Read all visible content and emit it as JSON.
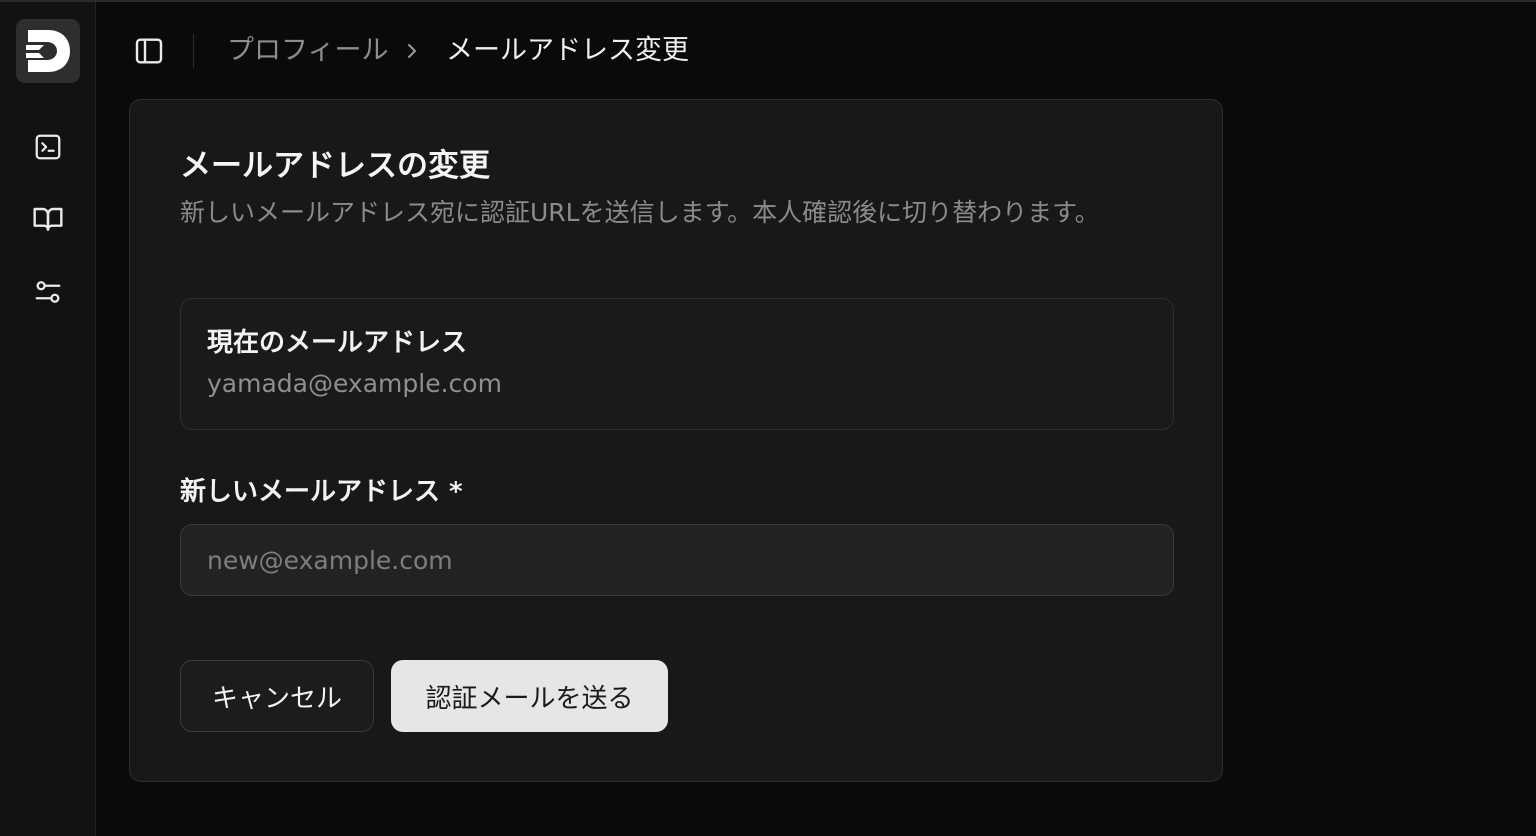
{
  "app": {
    "logo_icon": "d-logo-icon"
  },
  "sidebar": {
    "items": [
      {
        "icon": "terminal-icon"
      },
      {
        "icon": "book-open-icon"
      },
      {
        "icon": "settings-sliders-icon"
      }
    ]
  },
  "header": {
    "toggle_icon": "sidebar-toggle-icon",
    "breadcrumb": [
      "プロフィール",
      "メールアドレス変更"
    ],
    "separator_icon": "chevron-right-icon"
  },
  "card": {
    "title": "メールアドレスの変更",
    "description": "新しいメールアドレス宛に認証URLを送信します。本人確認後に切り替わります。",
    "current": {
      "label": "現在のメールアドレス",
      "value": "yamada@example.com"
    },
    "new_email": {
      "label": "新しいメールアドレス *",
      "value": "",
      "placeholder": "new@example.com"
    },
    "buttons": {
      "cancel": "キャンセル",
      "send": "認証メールを送る"
    }
  },
  "colors": {
    "background": "#0a0a0a",
    "sidebar": "#121212",
    "card": "#181818",
    "primary_button": "#e6e6e6"
  }
}
